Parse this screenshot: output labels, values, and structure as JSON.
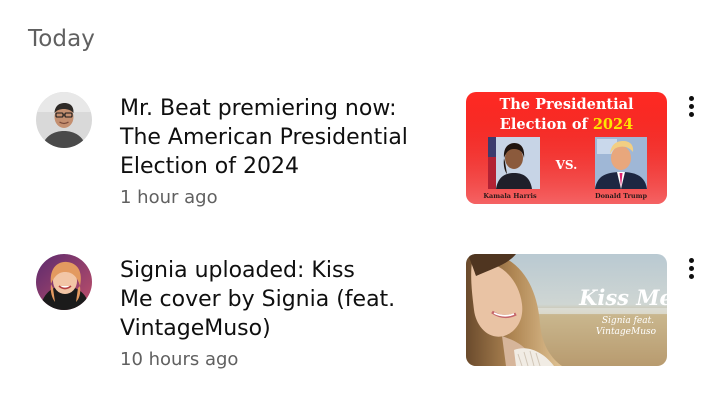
{
  "section": {
    "title": "Today"
  },
  "notifications": [
    {
      "title_lines": [
        "Mr. Beat premiering now:",
        "The American Presidential",
        "Election of 2024"
      ],
      "time": "1 hour ago",
      "avatar_icon": "person-avatar-icon",
      "thumbnail": {
        "title_line1": "The Presidential",
        "title_line2_prefix": "Election of ",
        "title_year": "2024",
        "vs": "VS.",
        "left_caption": "Kamala Harris",
        "right_caption": "Donald Trump",
        "bg_color": "#e8231f",
        "year_color": "#ffe600"
      },
      "menu_icon": "more-vert-icon"
    },
    {
      "title_lines": [
        "Signia uploaded: Kiss",
        "Me cover by Signia (feat.",
        "VintageMuso)"
      ],
      "time": "10 hours ago",
      "avatar_icon": "person-avatar-icon",
      "thumbnail": {
        "title": "Kiss Me",
        "subtitle_line1": "Signia feat.",
        "subtitle_line2": "VintageMuso"
      },
      "menu_icon": "more-vert-icon"
    }
  ]
}
